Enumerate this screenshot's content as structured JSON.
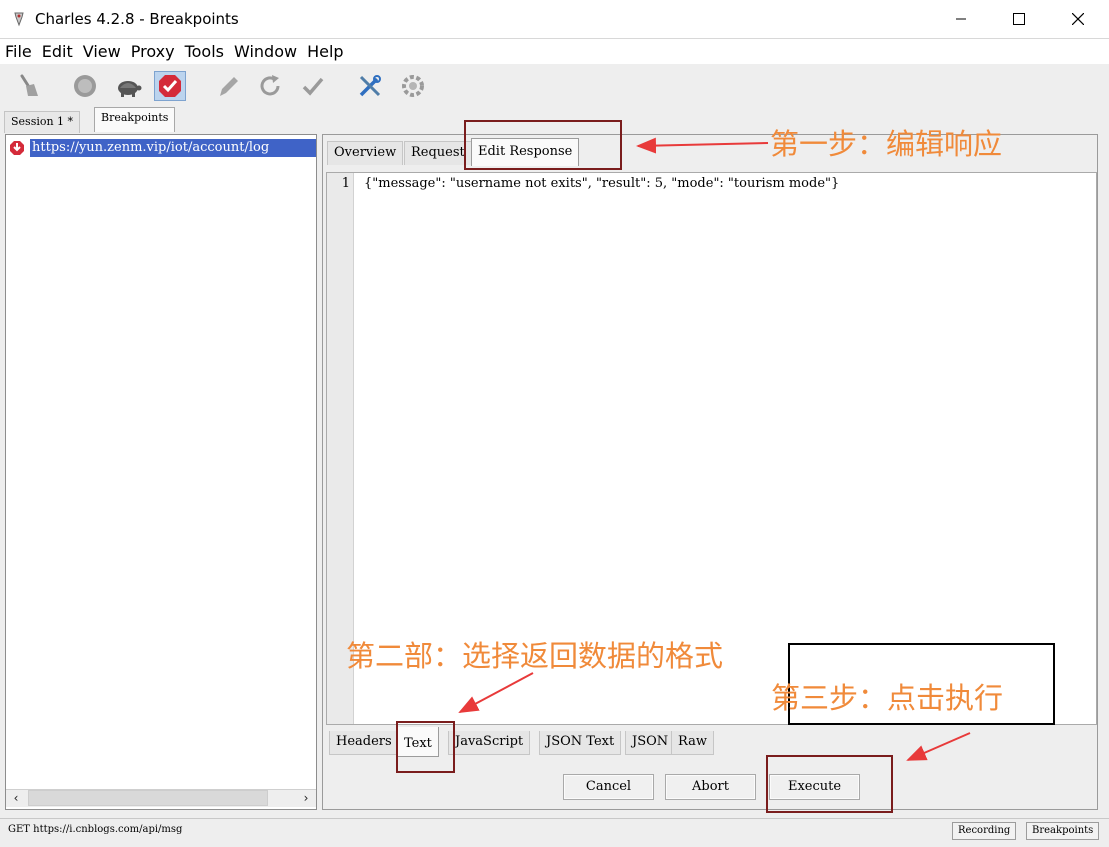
{
  "window": {
    "title": "Charles 4.2.8 - Breakpoints",
    "controls": [
      "minimize-icon",
      "maximize-icon",
      "close-icon"
    ]
  },
  "menu": [
    "File",
    "Edit",
    "View",
    "Proxy",
    "Tools",
    "Window",
    "Help"
  ],
  "toolbar": {
    "icons": [
      "broom-icon",
      "record-icon",
      "turtle-icon",
      "breakpoint-icon",
      "compose-icon",
      "repeat-icon",
      "validate-icon",
      "tools-icon",
      "settings-icon"
    ],
    "breakpoints_active": true
  },
  "session_tabs": [
    "Session 1 *",
    "Breakpoints"
  ],
  "left": {
    "request_url": "https://yun.zenm.vip/iot/account/log"
  },
  "right": {
    "tabs": [
      "Overview",
      "Request",
      "Edit Response"
    ],
    "active_tab": "Edit Response",
    "line_number": "1",
    "body": "{\"message\": \"username not exits\", \"result\": 5, \"mode\": \"tourism mode\"}",
    "format_tabs": [
      "Headers",
      "Text",
      "JavaScript",
      "JSON Text",
      "JSON",
      "Raw"
    ],
    "active_format": "Text",
    "buttons": {
      "cancel": "Cancel",
      "abort": "Abort",
      "execute": "Execute"
    }
  },
  "status": {
    "text": "GET https://i.cnblogs.com/api/msg",
    "recording": "Recording",
    "breakpoints": "Breakpoints"
  },
  "annotations": {
    "step1": "第一步：编辑响应",
    "step2": "第二部：选择返回数据的格式",
    "step3": "第三步：点击执行",
    "color": "#f08a3a",
    "arrow_color": "#e83a3a"
  }
}
